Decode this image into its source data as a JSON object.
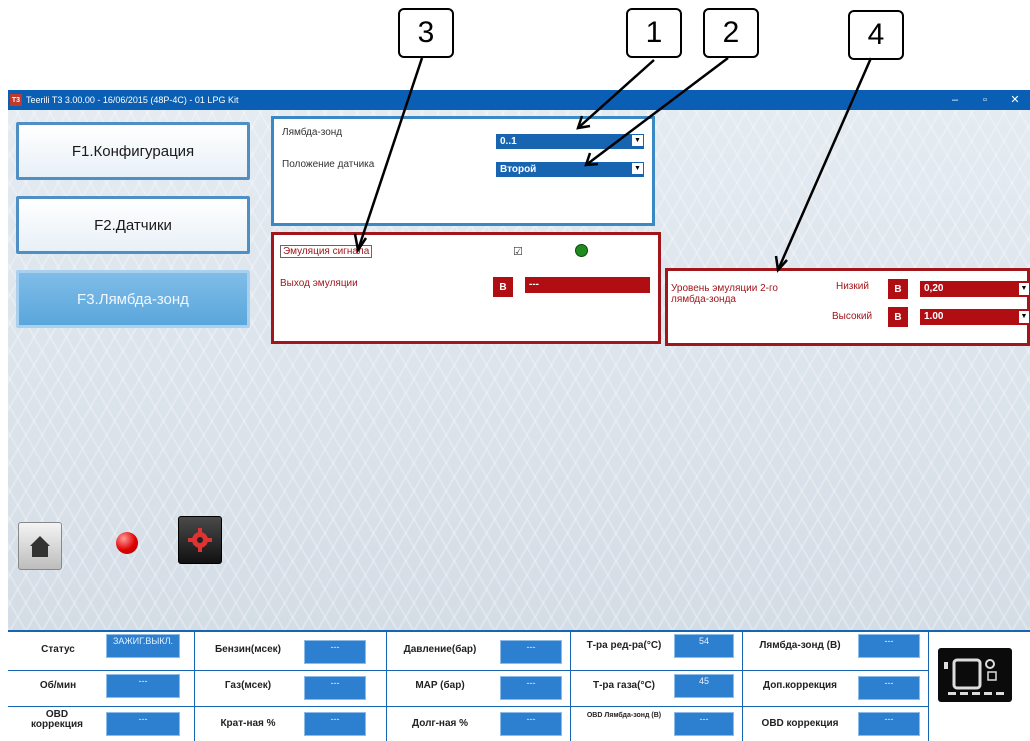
{
  "callouts": [
    "1",
    "2",
    "3",
    "4"
  ],
  "window": {
    "title": "Teerili T3 3.00.00 - 16/06/2015 (48P-4C) - 01 LPG Kit",
    "app_icon": "T3",
    "controls": [
      "–",
      "▫",
      "✕"
    ]
  },
  "nav": {
    "config": "F1.Конфигурация",
    "sensors": "F2.Датчики",
    "lambda": "F3.Лямбда-зонд"
  },
  "lambda_panel": {
    "probe_label": "Лямбда-зонд",
    "probe_value": "0..1",
    "position_label": "Положение датчика",
    "position_value": "Второй"
  },
  "emulation_panel": {
    "emulation_label": "Эмуляция сигнала",
    "emulation_checked": "☑",
    "output_label": "Выход эмуляции",
    "output_unit": "В",
    "output_value": "---"
  },
  "level_panel": {
    "title": "Уровень эмуляции 2-го лямбда-зонда",
    "low_label": "Низкий",
    "low_unit": "В",
    "low_value": "0,20",
    "high_label": "Высокий",
    "high_unit": "В",
    "high_value": "1.00"
  },
  "status_indicator_color": "#1f8a1f",
  "status": {
    "status_label": "Статус",
    "status_value": "ЗАЖИГ.ВЫКЛ.",
    "rpm_label": "Об/мин",
    "rpm_value": "---",
    "obd_corr_label": "OBD коррекция",
    "obd_corr_value": "---",
    "petrol_label": "Бензин(мсек)",
    "petrol_value": "---",
    "gas_label": "Газ(мсек)",
    "gas_value": "---",
    "short_label": "Крат-ная %",
    "short_value": "---",
    "pressure_label": "Давление(бар)",
    "pressure_value": "---",
    "map_label": "MAP (бар)",
    "map_value": "---",
    "long_label": "Долг-ная %",
    "long_value": "---",
    "reducer_label": "Т-ра ред-ра(°C)",
    "reducer_value": "54",
    "gas_temp_label": "Т-ра газа(°C)",
    "gas_temp_value": "45",
    "obd_lambda_label": "OBD Лямбда-зонд (В)",
    "obd_lambda_value": "---",
    "lambda_v_label": "Лямбда-зонд (В)",
    "lambda_v_value": "---",
    "extra_corr_label": "Доп.коррекция",
    "extra_corr_value": "---",
    "obd_corr2_label": "OBD коррекция",
    "obd_corr2_value": "---"
  }
}
